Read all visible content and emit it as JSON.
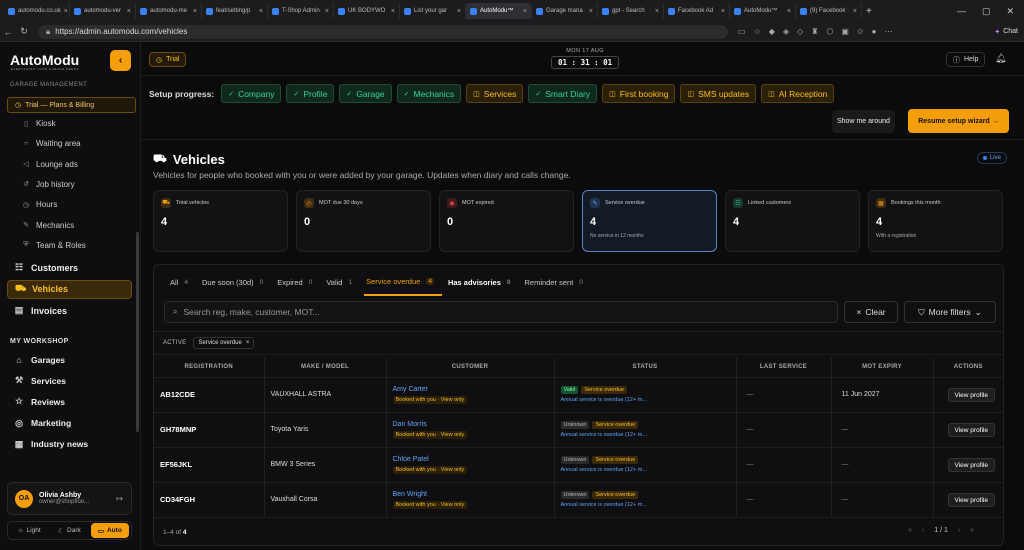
{
  "browser": {
    "tabs": [
      {
        "label": "automodu.co.uk"
      },
      {
        "label": "automodu-ver"
      },
      {
        "label": "automodu-me"
      },
      {
        "label": "feat/setting/p"
      },
      {
        "label": "T-Shop Admin"
      },
      {
        "label": "UK BODYWO"
      },
      {
        "label": "List your gar"
      },
      {
        "label": "AutoModu™"
      },
      {
        "label": "Garage mana"
      },
      {
        "label": "gpt - Search"
      },
      {
        "label": "Facebook Ad"
      },
      {
        "label": "AutoModu™"
      },
      {
        "label": "(9) Facebook"
      }
    ],
    "active_tab": 7,
    "url": "https://admin.automodu.com/vehicles",
    "chat_label": "Chat"
  },
  "sidebar": {
    "logo": "AutoModu",
    "logo_sub": "EVERYTHING YOUR GARAGE NEEDS",
    "section_garage": "GARAGE MANAGEMENT",
    "trial_item": "Trial — Plans & Billing",
    "sub_items": [
      {
        "label": "Kiosk",
        "icon": "tablet-icon"
      },
      {
        "label": "Waiting area",
        "icon": "chair-icon"
      },
      {
        "label": "Lounge ads",
        "icon": "megaphone-icon"
      },
      {
        "label": "Job history",
        "icon": "history-icon"
      },
      {
        "label": "Hours",
        "icon": "clock-icon"
      },
      {
        "label": "Mechanics",
        "icon": "wrench-icon"
      },
      {
        "label": "Team & Roles",
        "icon": "shield-icon"
      }
    ],
    "main_items": [
      {
        "label": "Customers",
        "icon": "users-icon"
      },
      {
        "label": "Vehicles",
        "icon": "car-icon"
      },
      {
        "label": "Invoices",
        "icon": "invoice-icon"
      }
    ],
    "section_workshop": "MY WORKSHOP",
    "workshop_items": [
      {
        "label": "Garages",
        "icon": "building-icon"
      },
      {
        "label": "Services",
        "icon": "tools-icon"
      },
      {
        "label": "Reviews",
        "icon": "star-icon"
      },
      {
        "label": "Marketing",
        "icon": "target-icon"
      },
      {
        "label": "Industry news",
        "icon": "news-icon"
      }
    ],
    "user": {
      "initials": "OA",
      "name": "Olivia Ashby",
      "email": "owner@shopfloo..."
    },
    "theme": {
      "light": "Light",
      "dark": "Dark",
      "auto": "Auto"
    }
  },
  "topbar": {
    "trial": "Trial",
    "date": "MON 17 AUG",
    "time": "01 : 31 : 01",
    "help": "Help"
  },
  "setup": {
    "label": "Setup progress:",
    "steps": [
      {
        "label": "Company",
        "done": true
      },
      {
        "label": "Profile",
        "done": true
      },
      {
        "label": "Garage",
        "done": true
      },
      {
        "label": "Mechanics",
        "done": true
      },
      {
        "label": "Services",
        "done": false
      },
      {
        "label": "Smart Diary",
        "done": true
      },
      {
        "label": "First booking",
        "done": false
      },
      {
        "label": "SMS updates",
        "done": false
      },
      {
        "label": "AI Reception",
        "done": false
      }
    ],
    "tour": "Show me around",
    "wizard": "Resume setup wizard →"
  },
  "page": {
    "title": "Vehicles",
    "subtitle": "Vehicles for people who booked with you or were added by your garage. Updates when diary and calls change.",
    "live": "Live"
  },
  "stats": [
    {
      "label": "Total vehicles",
      "value": "4",
      "note": "",
      "color": "#f59e0b"
    },
    {
      "label": "MOT due 30 days",
      "value": "0",
      "note": "",
      "color": "#f59e0b"
    },
    {
      "label": "MOT expired",
      "value": "0",
      "note": "",
      "color": "#ef4444"
    },
    {
      "label": "Service overdue",
      "value": "4",
      "note": "No service in 12 months",
      "color": "#60a5fa"
    },
    {
      "label": "Linked customers",
      "value": "4",
      "note": "",
      "color": "#34d399"
    },
    {
      "label": "Bookings this month",
      "value": "4",
      "note": "With a registration",
      "color": "#f59e0b"
    }
  ],
  "filters": [
    {
      "label": "All",
      "count": "4"
    },
    {
      "label": "Due soon (30d)",
      "count": "0"
    },
    {
      "label": "Expired",
      "count": "0"
    },
    {
      "label": "Valid",
      "count": "1"
    },
    {
      "label": "Service overdue",
      "count": "4"
    },
    {
      "label": "Has advisories",
      "count": "0"
    },
    {
      "label": "Reminder sent",
      "count": "0"
    }
  ],
  "search": {
    "placeholder": "Search reg, make, customer, MOT..."
  },
  "clear": "Clear",
  "more_filters": "More filters",
  "active": {
    "label": "ACTIVE",
    "chip": "Service overdue"
  },
  "table": {
    "headers": [
      "REGISTRATION",
      "MAKE / MODEL",
      "CUSTOMER",
      "STATUS",
      "LAST SERVICE",
      "MOT EXPIRY",
      "ACTIONS"
    ],
    "rows": [
      {
        "reg": "AB12CDE",
        "model": "VAUXHALL ASTRA",
        "customer": "Amy Carter",
        "tag": "Booked with you · View only",
        "status1": "Valid",
        "status2": "Service overdue",
        "note": "Annual service is overdue (12+ m...",
        "last": "—",
        "mot": "11 Jun 2027",
        "action": "View profile"
      },
      {
        "reg": "GH78MNP",
        "model": "Toyota Yaris",
        "customer": "Dan Morris",
        "tag": "Booked with you · View only",
        "status1": "Unknown",
        "status2": "Service overdue",
        "note": "Annual service is overdue (12+ m...",
        "last": "—",
        "mot": "—",
        "action": "View profile"
      },
      {
        "reg": "EF56JKL",
        "model": "BMW 3 Series",
        "customer": "Chloe Patel",
        "tag": "Booked with you · View only",
        "status1": "Unknown",
        "status2": "Service overdue",
        "note": "Annual service is overdue (12+ m...",
        "last": "—",
        "mot": "—",
        "action": "View profile"
      },
      {
        "reg": "CD34FGH",
        "model": "Vauxhall Corsa",
        "customer": "Ben Wright",
        "tag": "Booked with you · View only",
        "status1": "Unknown",
        "status2": "Service overdue",
        "note": "Annual service is overdue (12+ m...",
        "last": "—",
        "mot": "—",
        "action": "View profile"
      }
    ]
  },
  "footer": {
    "range": "1–4 of",
    "total": "4",
    "page": "1 / 1"
  }
}
